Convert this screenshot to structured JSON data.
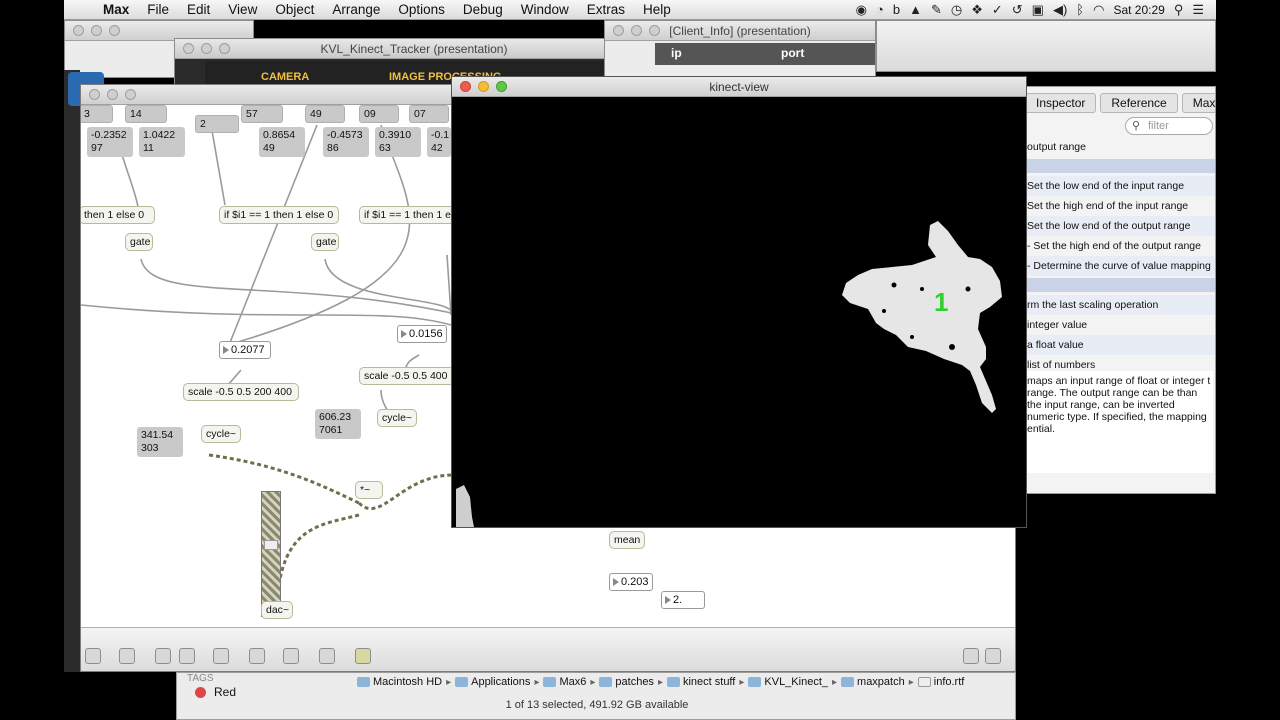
{
  "menubar": {
    "app": "Max",
    "items": [
      "File",
      "Edit",
      "View",
      "Object",
      "Arrange",
      "Options",
      "Debug",
      "Window",
      "Extras",
      "Help"
    ],
    "clock": "Sat 20:29"
  },
  "windows": {
    "tracker_title": "KVL_Kinect_Tracker (presentation)",
    "tracker_tabs": [
      "CAMERA",
      "IMAGE PROCESSING"
    ],
    "client_title": "[Client_Info] (presentation)",
    "client_cols": [
      "ip",
      "port"
    ],
    "kinect_title": "kinect-view",
    "blob_id": "1"
  },
  "inspector": {
    "tabs": [
      "Inspector",
      "Reference",
      "Max"
    ],
    "search_placeholder": "filter",
    "header_row": "output range",
    "rows": [
      "Set the low end of the input range",
      "Set the high end of the input range",
      "Set the low end of the output range",
      "- Set the high end of the output range",
      "- Determine the curve of value mapping",
      "rm the last scaling operation",
      "integer value",
      "a float value",
      "list of numbers"
    ],
    "description": "maps an input range of float or integer t range. The output range can be than the input range, can be inverted numeric type. If specified, the mapping ential."
  },
  "patch": {
    "top_msgs": [
      "3",
      "14",
      "57",
      "49",
      "09",
      "07"
    ],
    "top_msg_2": "2",
    "val_pairs": [
      {
        "a": "-0.2352",
        "b": "97"
      },
      {
        "a": "1.0422",
        "b": "11"
      },
      {
        "a": "0.8654",
        "b": "49"
      },
      {
        "a": "-0.4573",
        "b": "86"
      },
      {
        "a": "0.3910",
        "b": "63"
      },
      {
        "a": "-0.1",
        "b": "42"
      }
    ],
    "if_left": "then 1 else 0",
    "if_mid": "if $i1 == 1 then 1 else 0",
    "if_right": "if $i1 == 1 then 1 e",
    "gate": "gate",
    "num1": "0.2077",
    "num2": "0.0156",
    "scale1": "scale -0.5 0.5 200 400",
    "scale2": "scale -0.5 0.5 400",
    "val_a": {
      "a": "341.54",
      "b": "303"
    },
    "val_b": {
      "a": "606.23",
      "b": "7061"
    },
    "cycle": "cycle~",
    "times": "*~",
    "dac": "dac~",
    "mean": "mean",
    "num3": "0.203",
    "num4": "2."
  },
  "finder": {
    "tags_label": "TAGS",
    "tag": "Red",
    "path": [
      "Macintosh HD",
      "Applications",
      "Max6",
      "patches",
      "kinect stuff",
      "KVL_Kinect_",
      "maxpatch",
      "info.rtf"
    ],
    "status": "1 of 13 selected, 491.92 GB available"
  }
}
